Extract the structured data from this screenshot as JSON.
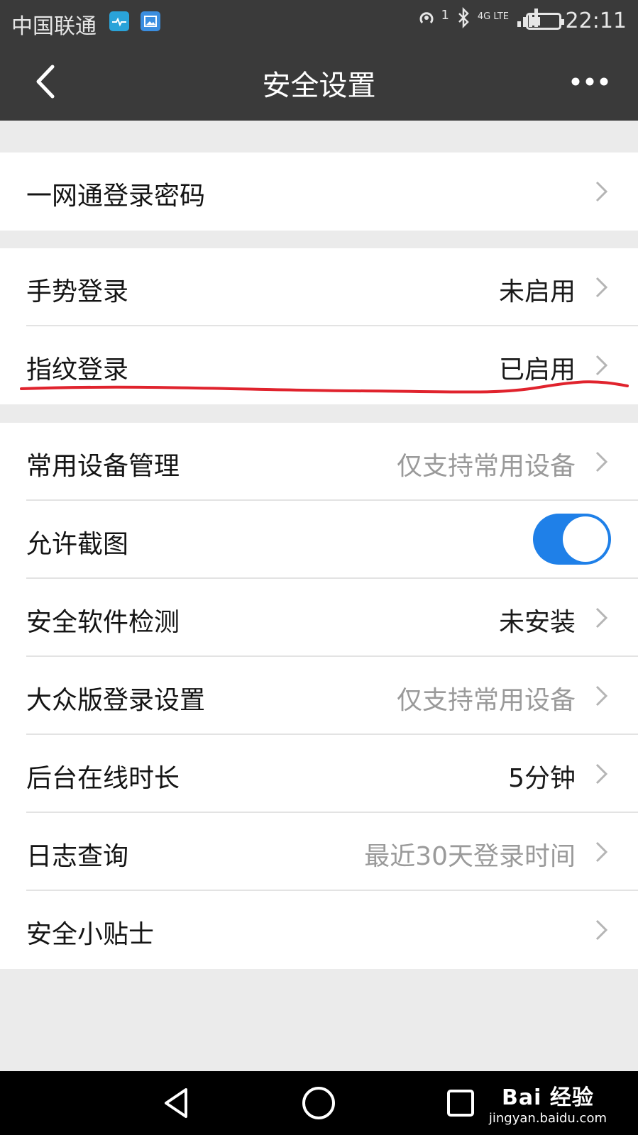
{
  "status_bar": {
    "carrier": "中国联通",
    "sim_indicator": "1",
    "network": "4G LTE",
    "time": "22:11",
    "icons": [
      "health-app-icon",
      "gallery-app-icon",
      "hotspot-icon",
      "bluetooth-icon",
      "signal-icon",
      "battery-icon"
    ]
  },
  "nav": {
    "title": "安全设置",
    "back_icon": "chevron-left-icon",
    "more_icon": "more-dots-icon"
  },
  "groups": [
    {
      "rows": [
        {
          "label": "一网通登录密码",
          "value": "",
          "value_style": "dark",
          "control": "chevron"
        }
      ]
    },
    {
      "rows": [
        {
          "label": "手势登录",
          "value": "未启用",
          "value_style": "dark",
          "control": "chevron"
        },
        {
          "label": "指纹登录",
          "value": "已启用",
          "value_style": "dark",
          "control": "chevron"
        }
      ]
    },
    {
      "rows": [
        {
          "label": "常用设备管理",
          "value": "仅支持常用设备",
          "value_style": "gray",
          "control": "chevron"
        },
        {
          "label": "允许截图",
          "value": "",
          "control": "toggle",
          "toggle_on": true
        },
        {
          "label": "安全软件检测",
          "value": "未安装",
          "value_style": "dark",
          "control": "chevron"
        },
        {
          "label": "大众版登录设置",
          "value": "仅支持常用设备",
          "value_style": "gray",
          "control": "chevron"
        },
        {
          "label": "后台在线时长",
          "value": "5分钟",
          "value_style": "dark",
          "control": "chevron"
        },
        {
          "label": "日志查询",
          "value": "最近30天登录时间",
          "value_style": "gray",
          "control": "chevron"
        },
        {
          "label": "安全小贴士",
          "value": "",
          "value_style": "dark",
          "control": "chevron"
        }
      ]
    }
  ],
  "colors": {
    "header_bg": "#3a3a3a",
    "page_bg": "#ebebeb",
    "toggle_on": "#1f80e8",
    "annotation_red": "#e0232d"
  },
  "watermark": {
    "main": "Bai 经验",
    "sub": "jingyan.baidu.com"
  },
  "system_nav": [
    "back-triangle-icon",
    "home-circle-icon",
    "recents-square-icon"
  ]
}
